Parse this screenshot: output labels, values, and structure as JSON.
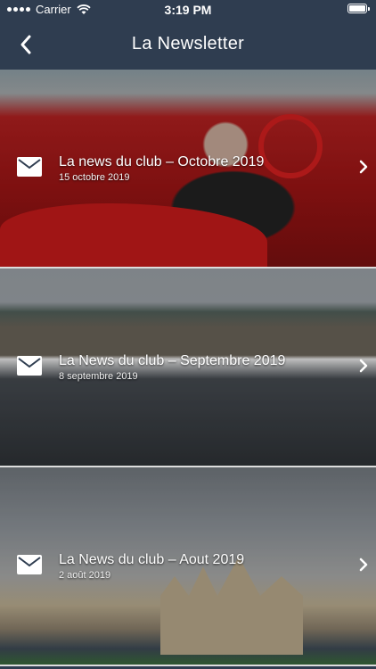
{
  "status_bar": {
    "carrier": "Carrier",
    "time": "3:19 PM"
  },
  "nav": {
    "title": "La Newsletter",
    "back_icon": "chevron-left-icon"
  },
  "newsletters": [
    {
      "title": "La news du club – Octobre 2019",
      "date": "15 octobre 2019"
    },
    {
      "title": "La News du club – Septembre 2019",
      "date": "8 septembre 2019"
    },
    {
      "title": "La News du club – Aout 2019",
      "date": "2 août 2019"
    }
  ],
  "colors": {
    "nav_background": "#2f3d50",
    "text": "#ffffff"
  }
}
